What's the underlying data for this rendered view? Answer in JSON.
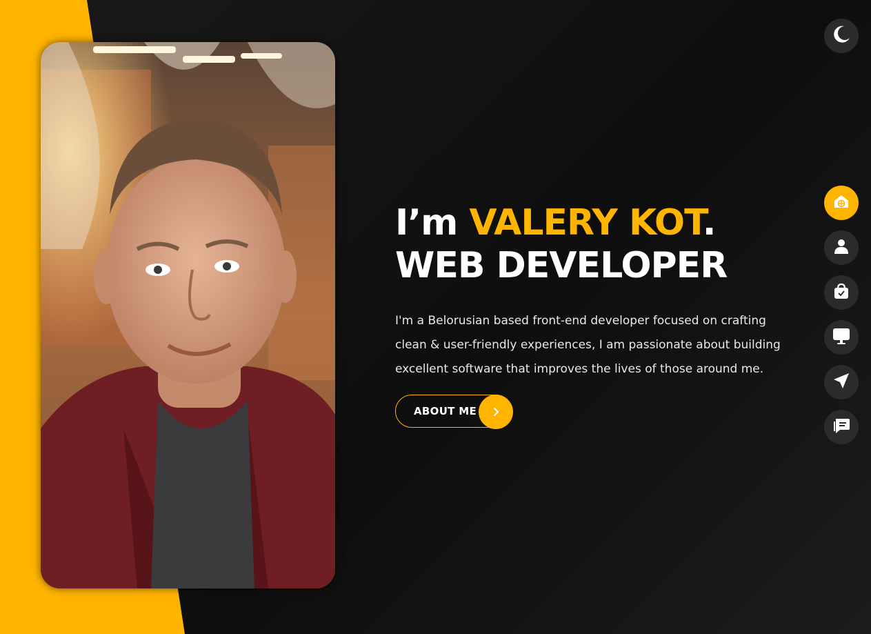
{
  "colors": {
    "accent": "#ffb400",
    "background": "#111111",
    "nav_bg": "#2b2b2b",
    "text": "#ffffff"
  },
  "hero": {
    "greeting": "I’m ",
    "name": "VALERY KOT",
    "period": ".",
    "role": "WEB DEVELOPER",
    "description": "I'm a Belorusian based front-end developer focused on crafting clean & user-friendly experiences, I am passionate about building excellent software that improves the lives of those around me."
  },
  "about_button": {
    "label": "ABOUT ME",
    "icon": "chevron-right-icon"
  },
  "theme_toggle": {
    "icon": "moon-icon"
  },
  "nav": {
    "items": [
      {
        "icon": "home-icon",
        "active": true
      },
      {
        "icon": "user-icon",
        "active": false
      },
      {
        "icon": "briefcase-icon",
        "active": false
      },
      {
        "icon": "monitor-icon",
        "active": false
      },
      {
        "icon": "paper-plane-icon",
        "active": false
      },
      {
        "icon": "chat-icon",
        "active": false
      }
    ]
  }
}
